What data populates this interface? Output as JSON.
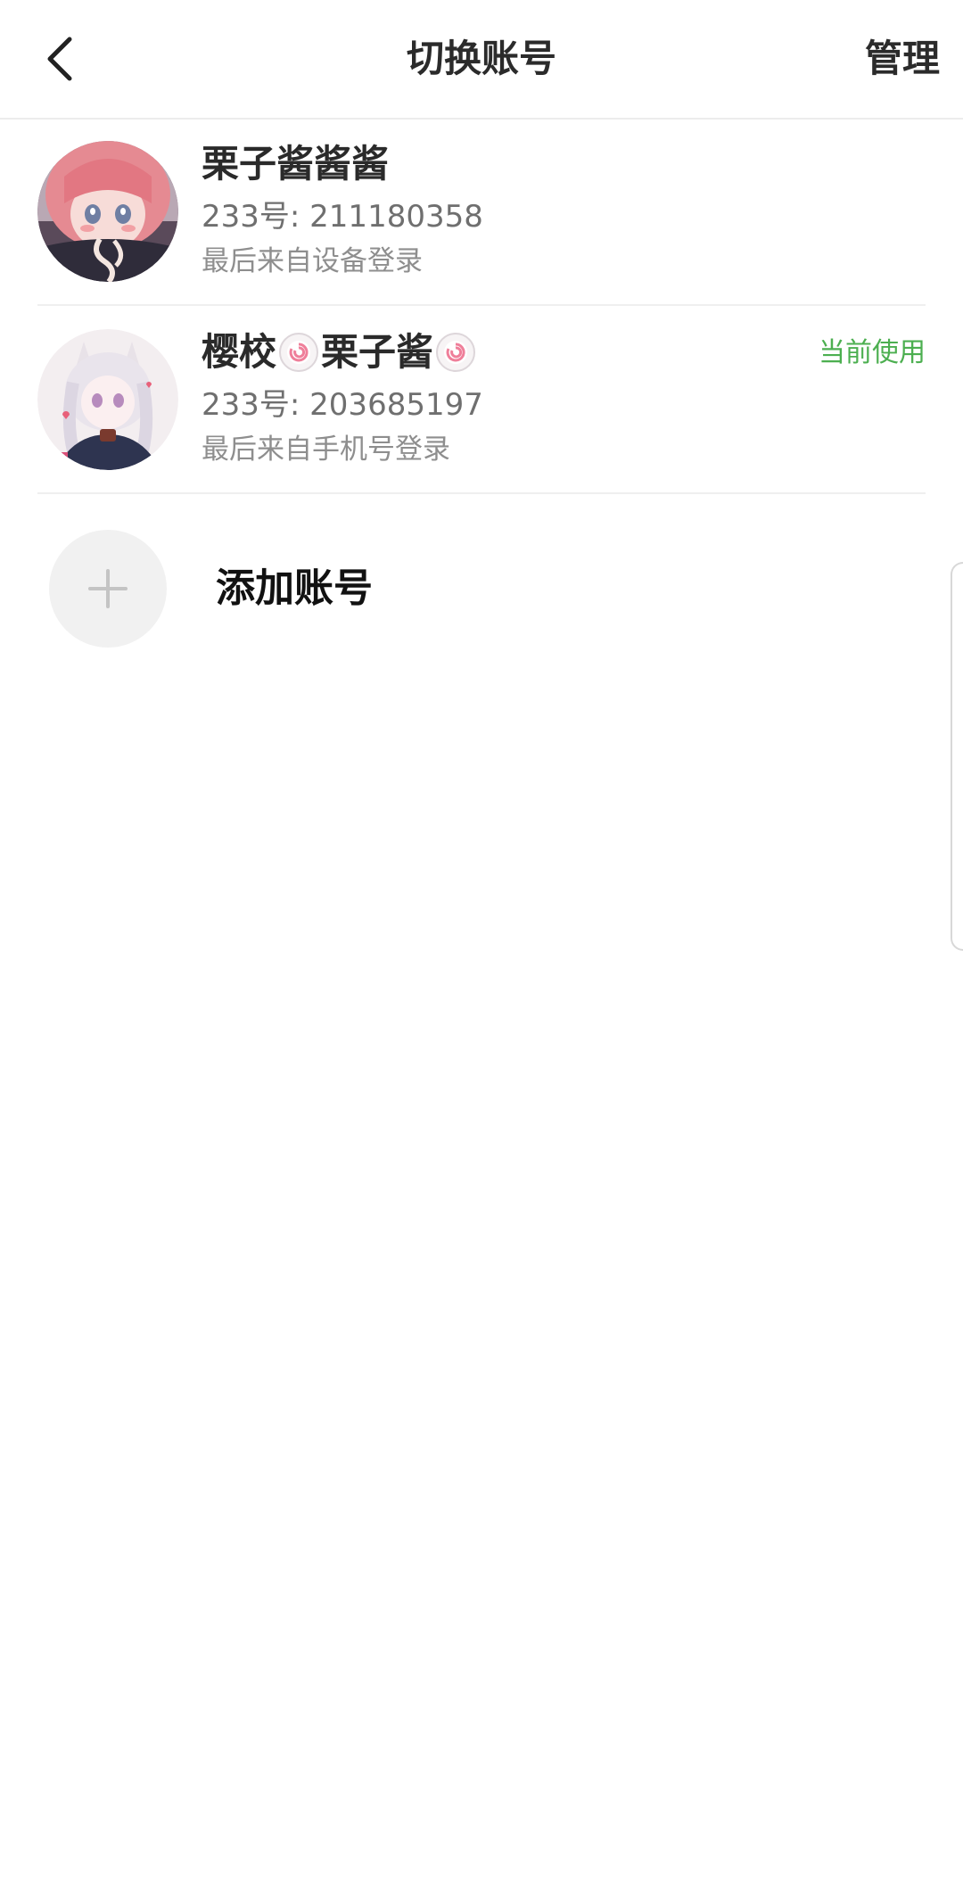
{
  "header": {
    "title": "切换账号",
    "manage_label": "管理"
  },
  "accounts": [
    {
      "name": "栗子酱酱酱",
      "uid_label": "233号: ",
      "uid": "211180358",
      "last_login": "最后来自设备登录",
      "current": false
    },
    {
      "name_parts": [
        "樱校",
        "栗子酱"
      ],
      "uid_label": "233号: ",
      "uid": "203685197",
      "last_login": "最后来自手机号登录",
      "current": true,
      "current_label": "当前使用"
    }
  ],
  "add_account": {
    "label": "添加账号"
  },
  "colors": {
    "accent_green": "#4caf50",
    "divider": "#efefef"
  }
}
